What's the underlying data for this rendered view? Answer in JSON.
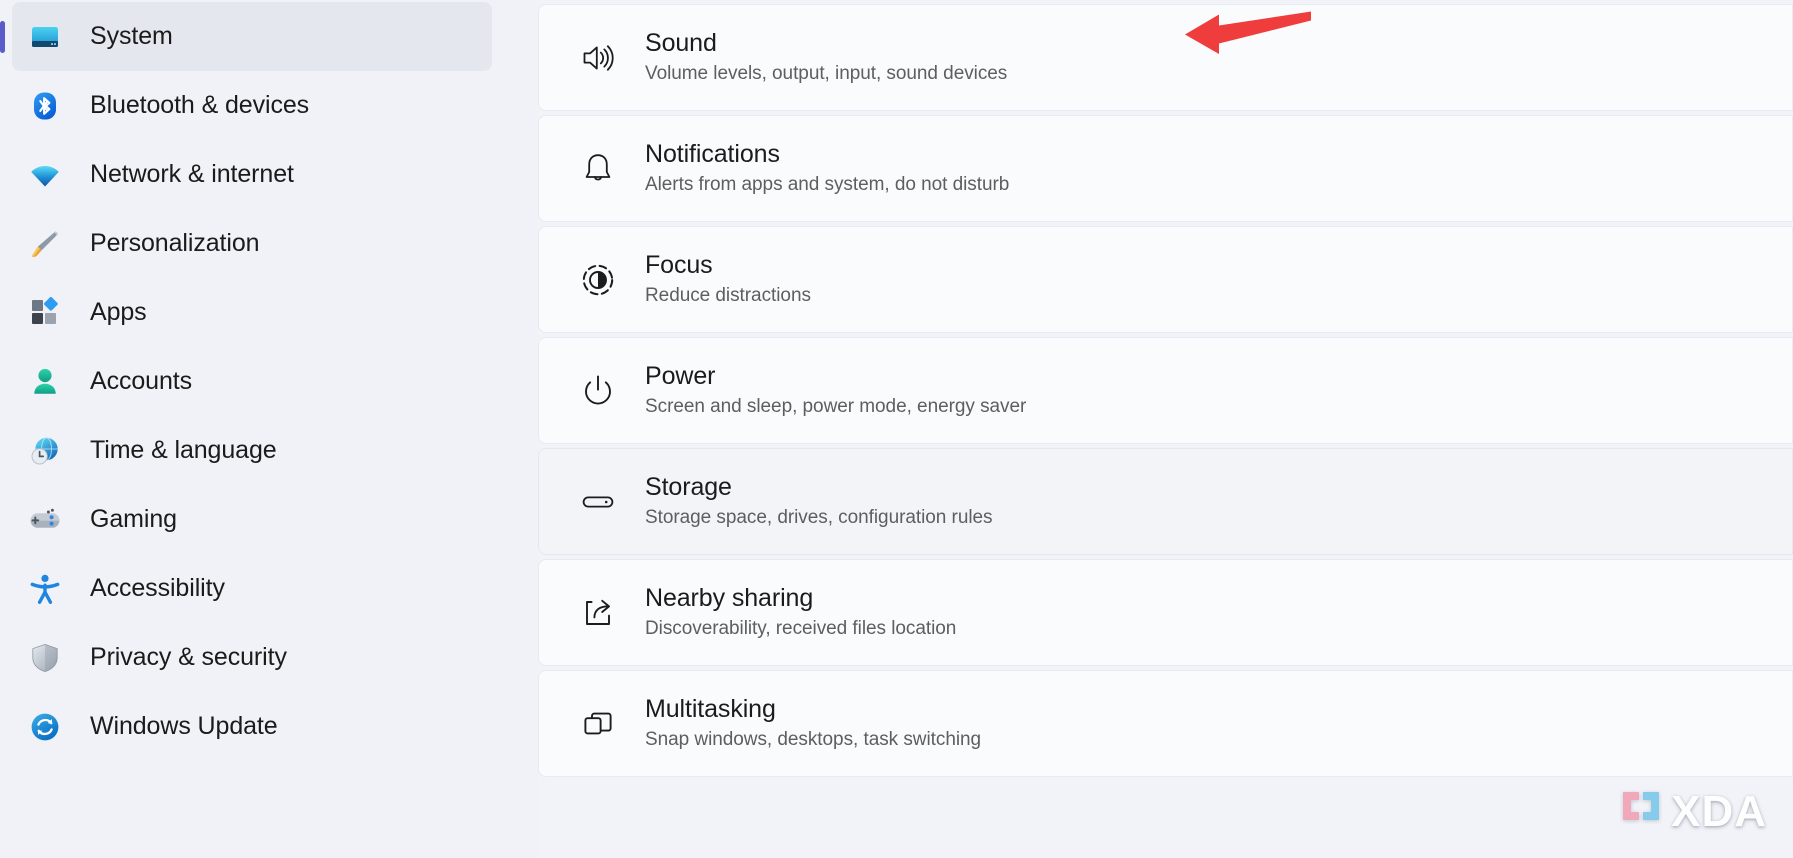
{
  "sidebar": {
    "items": [
      {
        "label": "System",
        "icon": "monitor-icon",
        "selected": true
      },
      {
        "label": "Bluetooth & devices",
        "icon": "bluetooth-icon",
        "selected": false
      },
      {
        "label": "Network & internet",
        "icon": "wifi-icon",
        "selected": false
      },
      {
        "label": "Personalization",
        "icon": "paintbrush-icon",
        "selected": false
      },
      {
        "label": "Apps",
        "icon": "apps-grid-icon",
        "selected": false
      },
      {
        "label": "Accounts",
        "icon": "person-icon",
        "selected": false
      },
      {
        "label": "Time & language",
        "icon": "globe-clock-icon",
        "selected": false
      },
      {
        "label": "Gaming",
        "icon": "gamepad-icon",
        "selected": false
      },
      {
        "label": "Accessibility",
        "icon": "accessibility-icon",
        "selected": false
      },
      {
        "label": "Privacy & security",
        "icon": "shield-icon",
        "selected": false
      },
      {
        "label": "Windows Update",
        "icon": "update-refresh-icon",
        "selected": false
      }
    ],
    "selected_accent_color": "#5B5BC9",
    "background_color": "#F0F2F7"
  },
  "main": {
    "rows": [
      {
        "title": "Sound",
        "subtitle": "Volume levels, output, input, sound devices",
        "icon": "speaker-icon",
        "hovered": false
      },
      {
        "title": "Notifications",
        "subtitle": "Alerts from apps and system, do not disturb",
        "icon": "bell-icon",
        "hovered": false
      },
      {
        "title": "Focus",
        "subtitle": "Reduce distractions",
        "icon": "focus-icon",
        "hovered": false
      },
      {
        "title": "Power",
        "subtitle": "Screen and sleep, power mode, energy saver",
        "icon": "power-icon",
        "hovered": false
      },
      {
        "title": "Storage",
        "subtitle": "Storage space, drives, configuration rules",
        "icon": "harddrive-icon",
        "hovered": true
      },
      {
        "title": "Nearby sharing",
        "subtitle": "Discoverability, received files location",
        "icon": "share-icon",
        "hovered": false
      },
      {
        "title": "Multitasking",
        "subtitle": "Snap windows, desktops, task switching",
        "icon": "multitasking-icon",
        "hovered": false
      }
    ],
    "card_background_color": "#FAFBFD",
    "card_hover_background_color": "#F2F4F8"
  },
  "annotation": {
    "arrow": {
      "name": "red-arrow-pointing-to-sound",
      "color": "#EF3C3C",
      "direction": "left",
      "points_to": "Sound"
    }
  },
  "watermark": {
    "text": "XDA",
    "bubble_left_color": "#F2A3B6",
    "bubble_right_color": "#7FC8EC",
    "text_color": "#FFFFFF"
  }
}
